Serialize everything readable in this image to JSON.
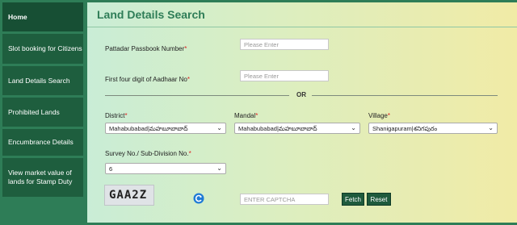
{
  "sidebar": {
    "items": [
      {
        "label": "Home"
      },
      {
        "label": "Slot booking for Citizens"
      },
      {
        "label": "Land Details Search"
      },
      {
        "label": "Prohibited Lands"
      },
      {
        "label": "Encumbrance Details"
      },
      {
        "label": "View market value of lands for Stamp Duty"
      }
    ]
  },
  "page": {
    "title": "Land Details Search"
  },
  "form": {
    "passbook": {
      "label": "Pattadar Passbook Number",
      "placeholder": "Please Enter"
    },
    "aadhaar": {
      "label": "First four digit of Aadhaar No",
      "placeholder": "Please Enter"
    },
    "or_text": "OR",
    "required_mark": "*",
    "district": {
      "label": "District",
      "value": "Mahabubabad|మహబూబాబాద్"
    },
    "mandal": {
      "label": "Mandal",
      "value": "Mahabubabad|మహబూబాబాద్"
    },
    "village": {
      "label": "Village",
      "value": "Shanigapuram|శనిగపురం"
    },
    "survey": {
      "label": "Survey No./ Sub-Division No.",
      "value": "6"
    },
    "captcha": {
      "text": "GAA2Z",
      "placeholder": "ENTER CAPTCHA"
    },
    "buttons": {
      "fetch": "Fetch",
      "reset": "Reset"
    }
  },
  "colors": {
    "accent": "#2e7d57",
    "sidebar_item": "#1e5e3e",
    "button": "#1f5b3d"
  }
}
